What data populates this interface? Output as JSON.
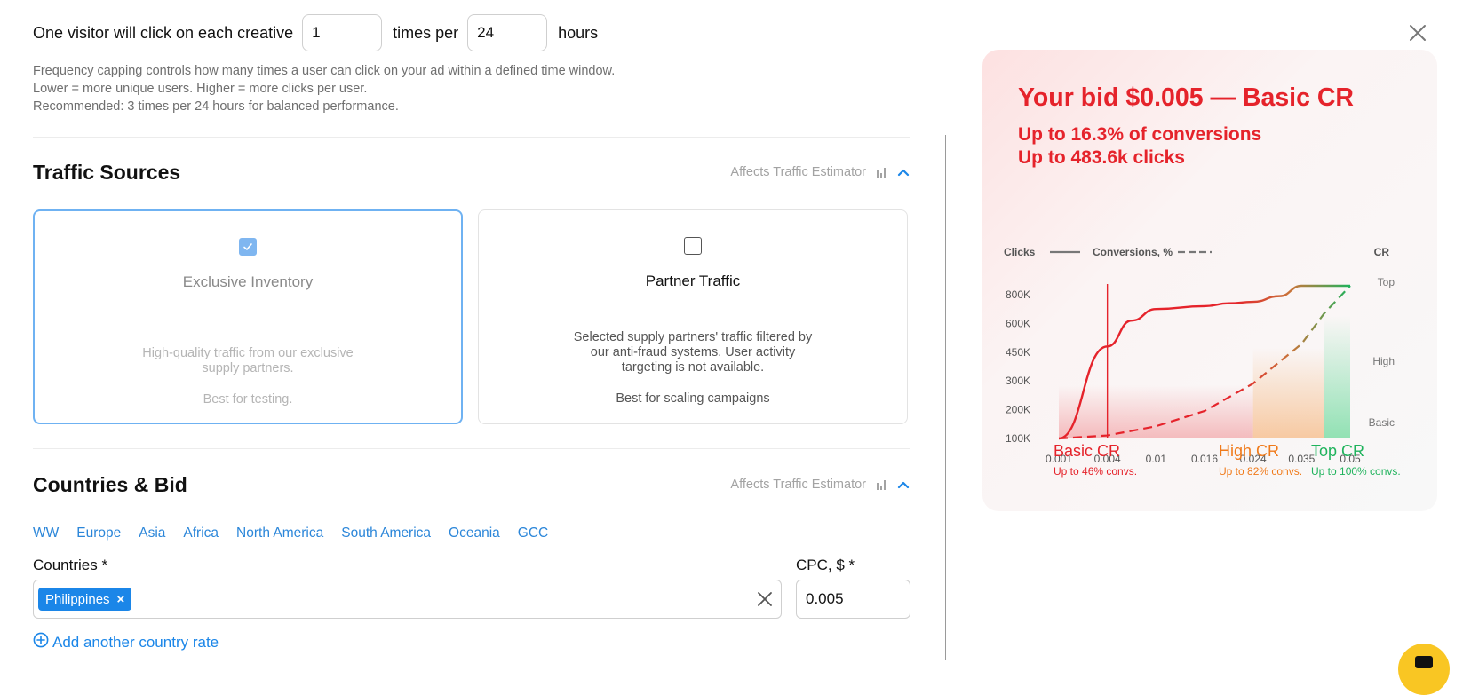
{
  "frequency": {
    "text_before": "One visitor will click on each creative",
    "clicks_value": "1",
    "text_middle": "times per",
    "hours_value": "24",
    "text_after": "hours",
    "help": [
      "Frequency capping controls how many times a user can click on your ad within a defined time window.",
      "Lower = more unique users. Higher = more clicks per user.",
      "Recommended: 3 times per 24 hours for balanced performance."
    ]
  },
  "traffic_sources": {
    "title": "Traffic Sources",
    "affects_label": "Affects Traffic Estimator",
    "cards": [
      {
        "title": "Exclusive Inventory",
        "checked": true,
        "description": "High-quality traffic from our exclusive supply partners.",
        "note": "Best for testing."
      },
      {
        "title": "Partner Traffic",
        "checked": false,
        "description": "Selected supply partners' traffic filtered by our anti-fraud systems. User activity targeting is not available.",
        "note": "Best for scaling campaigns"
      }
    ]
  },
  "countries_bid": {
    "title": "Countries & Bid",
    "affects_label": "Affects Traffic Estimator",
    "regions": [
      "WW",
      "Europe",
      "Asia",
      "Africa",
      "North America",
      "South America",
      "Oceania",
      "GCC"
    ],
    "countries_label": "Countries *",
    "selected_country": "Philippines",
    "cpc_label": "CPC, $ *",
    "cpc_value": "0.005",
    "add_country_label": "Add another country rate"
  },
  "estimator": {
    "title": "Your bid $0.005 — Basic CR",
    "line1": "Up to 16.3% of conversions",
    "line2": "Up to 483.6k clicks",
    "colors": {
      "basic": "#e5232b",
      "high": "#f07a1a",
      "top": "#1fb35c"
    },
    "legend": {
      "clicks": "Clicks",
      "conversions": "Conversions, %",
      "cr": "CR"
    },
    "zones": [
      {
        "name": "Basic CR",
        "sub": "Up to 46% convs."
      },
      {
        "name": "High CR",
        "sub": "Up to 82% convs."
      },
      {
        "name": "Top CR",
        "sub": "Up to 100% convs."
      }
    ],
    "zone_labels": [
      "Top",
      "High",
      "Basic"
    ]
  },
  "chart_data": {
    "type": "line",
    "x_ticks": [
      "0.001",
      "0.004",
      "0.01",
      "0.016",
      "0.024",
      "0.035",
      "0.05"
    ],
    "y_ticks": [
      "100K",
      "200K",
      "300K",
      "450K",
      "600K",
      "800K"
    ],
    "current_bid_x": 0.004,
    "series": [
      {
        "name": "Clicks",
        "style": "solid",
        "points": [
          [
            0.001,
            100000
          ],
          [
            0.004,
            480000
          ],
          [
            0.007,
            620000
          ],
          [
            0.01,
            700000
          ],
          [
            0.016,
            720000
          ],
          [
            0.02,
            740000
          ],
          [
            0.024,
            750000
          ],
          [
            0.03,
            790000
          ],
          [
            0.035,
            810000
          ],
          [
            0.042,
            820000
          ],
          [
            0.05,
            830000
          ]
        ]
      },
      {
        "name": "Conversions, %",
        "style": "dashed",
        "points": [
          [
            0.001,
            0
          ],
          [
            0.004,
            2
          ],
          [
            0.01,
            8
          ],
          [
            0.016,
            18
          ],
          [
            0.024,
            36
          ],
          [
            0.035,
            62
          ],
          [
            0.042,
            82
          ],
          [
            0.05,
            100
          ]
        ]
      }
    ],
    "zones": [
      {
        "name": "Basic",
        "from": 0.001,
        "to": 0.024
      },
      {
        "name": "High",
        "from": 0.024,
        "to": 0.042
      },
      {
        "name": "Top",
        "from": 0.042,
        "to": 0.05
      }
    ]
  }
}
